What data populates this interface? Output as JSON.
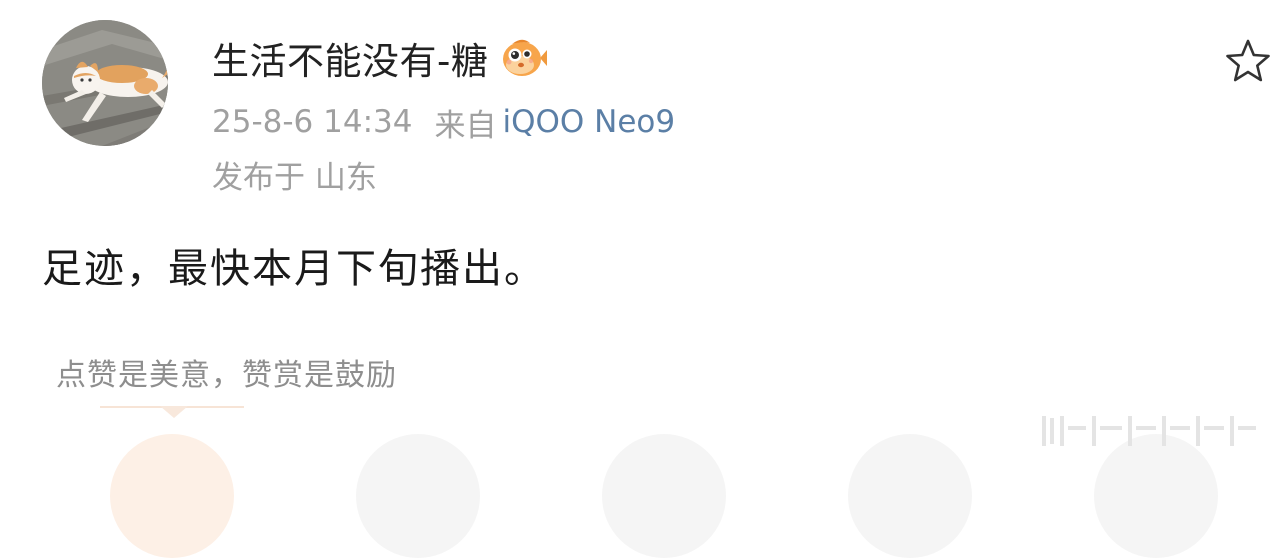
{
  "post": {
    "author": {
      "name": "生活不能没有-糖",
      "badge_icon": "fish-badge-icon"
    },
    "timestamp": "25-8-6 14:34",
    "source_prefix": "来自",
    "device": "iQOO Neo9",
    "location": "发布于 山东",
    "text": "足迹，最快本月下旬播出。",
    "star_icon": "star-outline-icon"
  },
  "reward": {
    "caption": "点赞是美意，赞赏是鼓励",
    "options_count_visible": 5
  },
  "colors": {
    "link_blue": "#5b7fa6",
    "meta_gray": "#a0a0a0",
    "caption_gray": "#8e8e8e",
    "accent_peach": "#fdf0e6"
  }
}
